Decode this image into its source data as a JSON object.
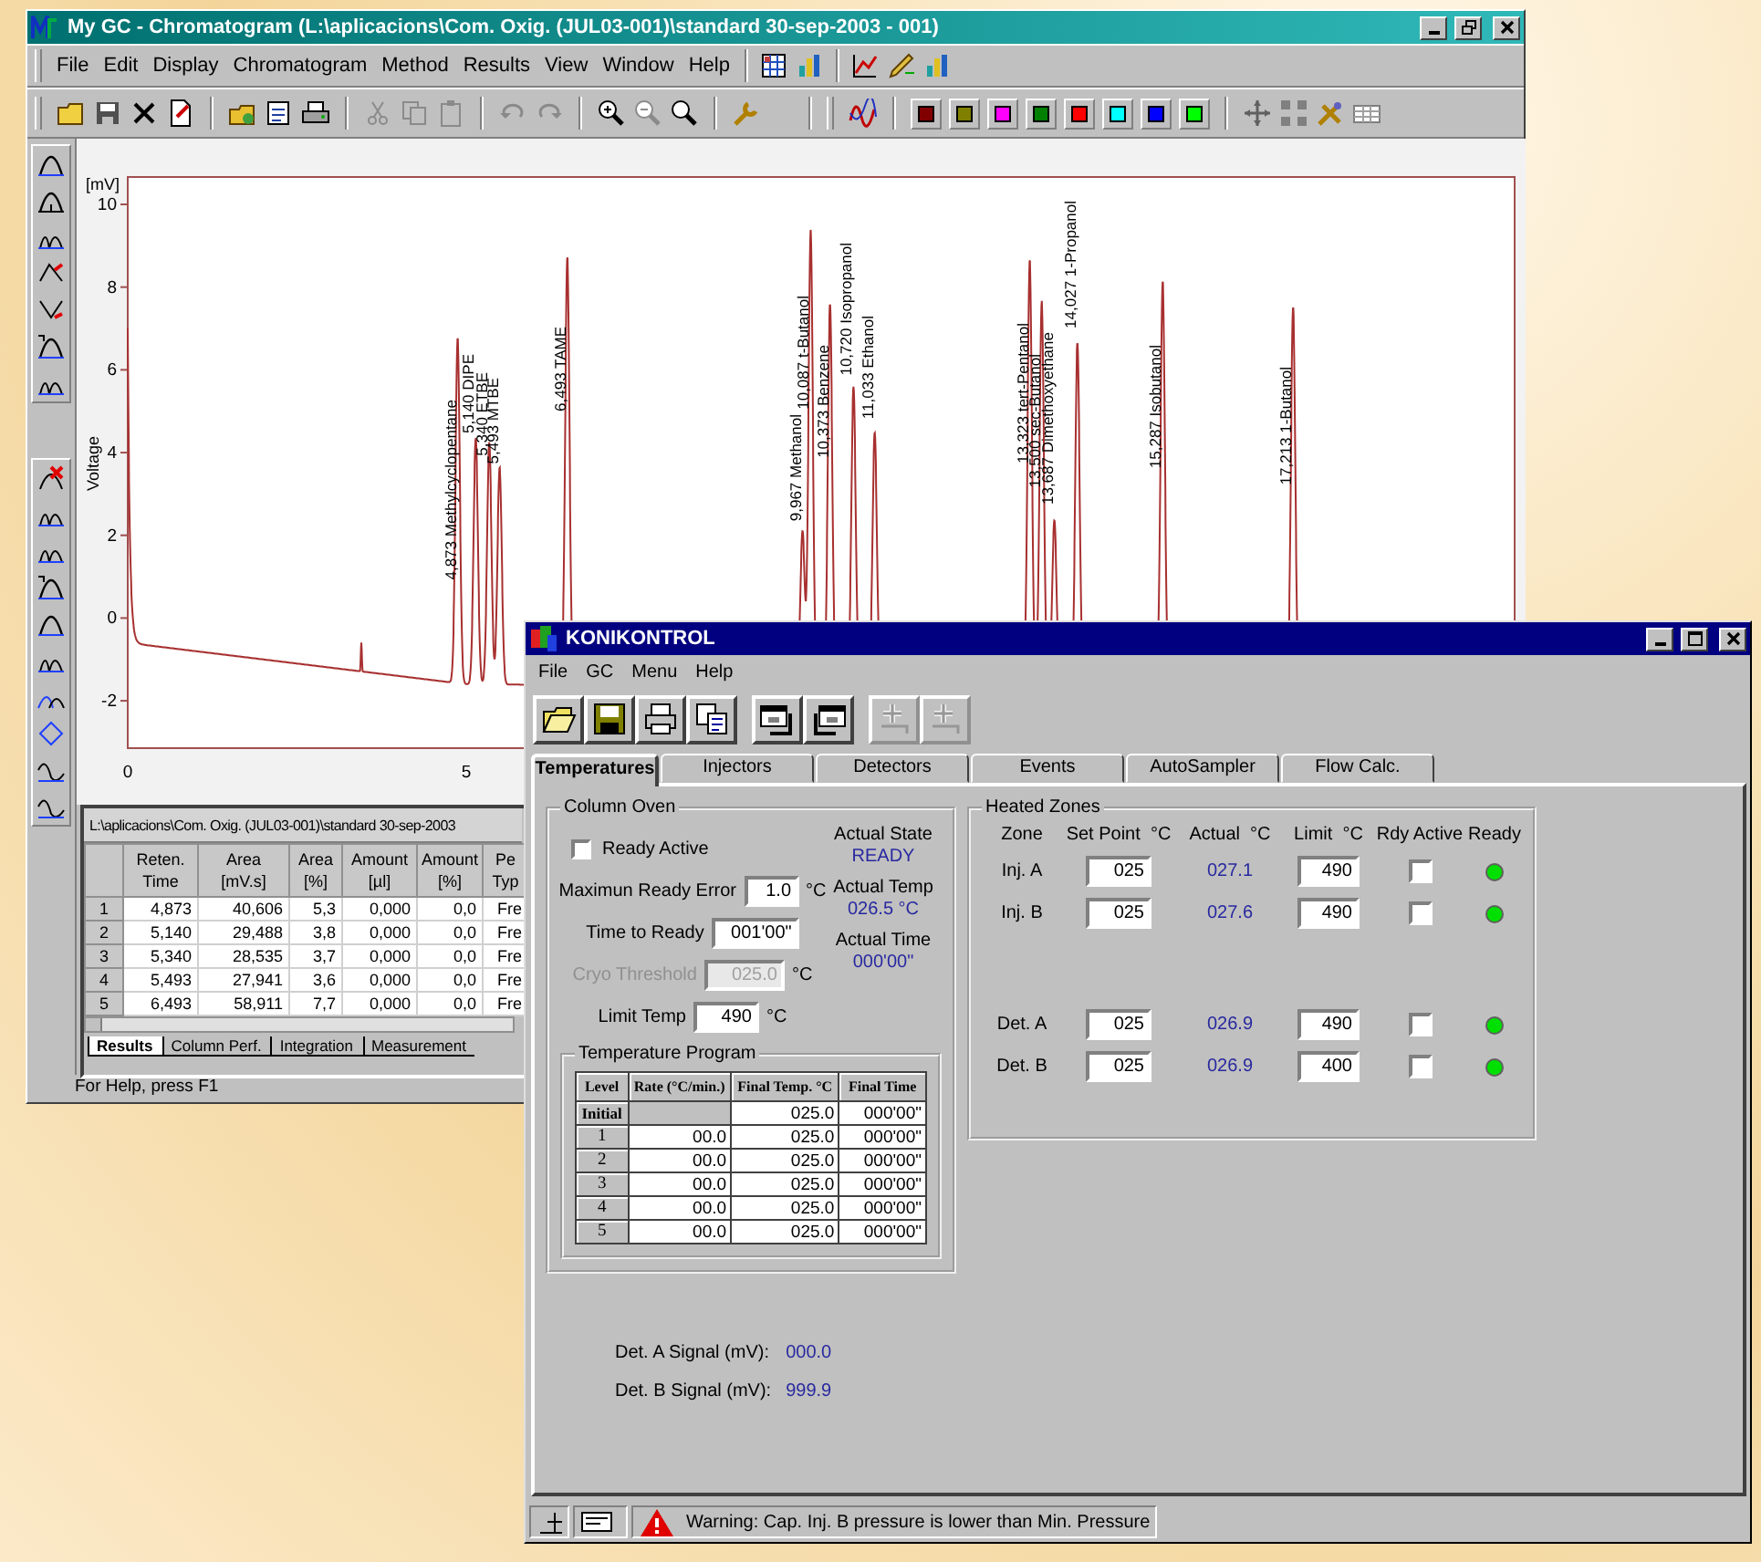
{
  "gc_window": {
    "title": "My GC - Chromatogram (L:\\aplicacions\\Com. Oxig. (JUL03-001)\\standard 30-sep-2003 - 001)",
    "menu": [
      "File",
      "Edit",
      "Display",
      "Chromatogram",
      "Method",
      "Results",
      "View",
      "Window",
      "Help"
    ],
    "trace_colors": [
      {
        "color": "#800000"
      },
      {
        "color": "#808000"
      },
      {
        "color": "#ff00ff"
      },
      {
        "color": "#008000"
      },
      {
        "color": "#ff0000"
      },
      {
        "color": "#00ffff"
      },
      {
        "color": "#0000ff"
      },
      {
        "color": "#00ff00"
      }
    ],
    "chart": {
      "y_unit": "[mV]",
      "y_title": "Voltage",
      "y_ticks": [
        "10",
        "8",
        "6",
        "4",
        "2",
        "0",
        "-2"
      ],
      "x_ticks": [
        "0",
        "5"
      ],
      "peak_labels": [
        "4,873 Methylcyclopentane",
        "5,140 DIPE",
        "5,340 ETBE",
        "5,493 MTBE",
        "6,493 TAME",
        "9,967 Methanol",
        "10,087 t-Butanol",
        "10,373 Benzene",
        "10,720 Isopropanol",
        "11,033 Ethanol",
        "13,323 tert-Pentanol",
        "13,500 sec-Butanol",
        "13,687 Dimethoxyethane",
        "14,027 1-Propanol",
        "15,287 Isobutanol",
        "17,213 1-Butanol"
      ]
    },
    "results": {
      "path": "L:\\aplicacions\\Com. Oxig. (JUL03-001)\\standard 30-sep-2003",
      "columns": [
        "",
        "Reten. Time",
        "Area [mV.s]",
        "Area [%]",
        "Amount [µl]",
        "Amount [%]",
        "Pe Typ"
      ],
      "rows": [
        [
          "1",
          "4,873",
          "40,606",
          "5,3",
          "0,000",
          "0,0",
          "Fre"
        ],
        [
          "2",
          "5,140",
          "29,488",
          "3,8",
          "0,000",
          "0,0",
          "Fre"
        ],
        [
          "3",
          "5,340",
          "28,535",
          "3,7",
          "0,000",
          "0,0",
          "Fre"
        ],
        [
          "4",
          "5,493",
          "27,941",
          "3,6",
          "0,000",
          "0,0",
          "Fre"
        ],
        [
          "5",
          "6,493",
          "58,911",
          "7,7",
          "0,000",
          "0,0",
          "Fre"
        ]
      ],
      "tabs": [
        {
          "label": "Results",
          "selected": true
        },
        {
          "label": "Column Perf.",
          "selected": false
        },
        {
          "label": "Integration",
          "selected": false
        },
        {
          "label": "Measurement",
          "selected": false
        }
      ]
    },
    "status_bar": "For Help, press F1"
  },
  "konikontrol": {
    "title": "KONIKONTROL",
    "menu": [
      "File",
      "GC",
      "Menu",
      "Help"
    ],
    "toolbar": [
      {
        "kind": "open",
        "disabled": false
      },
      {
        "kind": "save",
        "disabled": false
      },
      {
        "kind": "print",
        "disabled": false
      },
      {
        "kind": "copy",
        "disabled": false
      },
      {
        "kind": "window-in",
        "disabled": false
      },
      {
        "kind": "window-out",
        "disabled": false
      },
      {
        "kind": "add",
        "disabled": true
      },
      {
        "kind": "add",
        "disabled": true
      }
    ],
    "tabs": [
      {
        "label": "Temperatures",
        "selected": true
      },
      {
        "label": "Injectors",
        "selected": false
      },
      {
        "label": "Detectors",
        "selected": false
      },
      {
        "label": "Events",
        "selected": false
      },
      {
        "label": "AutoSampler",
        "selected": false
      },
      {
        "label": "Flow Calc.",
        "selected": false
      }
    ],
    "column_oven": {
      "title": "Column Oven",
      "ready_active": {
        "label": "Ready Active",
        "checked": false
      },
      "fields": [
        {
          "label": "Maximun Ready Error",
          "value": "1.0",
          "unit": "°C",
          "disabled": false
        },
        {
          "label": "Time to Ready",
          "value": "001'00\"",
          "disabled": false
        },
        {
          "label": "Cryo Threshold",
          "value": "025.0",
          "unit": "°C",
          "disabled": true
        },
        {
          "label": "Limit Temp",
          "value": "490",
          "unit": "°C",
          "disabled": false
        }
      ],
      "actual": [
        {
          "label": "Actual State",
          "value": "READY"
        },
        {
          "label": "Actual Temp",
          "value": "026.5  °C"
        },
        {
          "label": "Actual Time",
          "value": "000'00\""
        }
      ],
      "program": {
        "title": "Temperature Program",
        "columns": [
          "Level",
          "Rate (°C/min.)",
          "Final Temp. °C",
          "Final Time"
        ],
        "rows": [
          {
            "level": "Initial",
            "final_temp": "025.0",
            "final_time": "000'00\""
          },
          {
            "level": "1",
            "rate": "00.0",
            "final_temp": "025.0",
            "final_time": "000'00\""
          },
          {
            "level": "2",
            "rate": "00.0",
            "final_temp": "025.0",
            "final_time": "000'00\""
          },
          {
            "level": "3",
            "rate": "00.0",
            "final_temp": "025.0",
            "final_time": "000'00\""
          },
          {
            "level": "4",
            "rate": "00.0",
            "final_temp": "025.0",
            "final_time": "000'00\""
          },
          {
            "level": "5",
            "rate": "00.0",
            "final_temp": "025.0",
            "final_time": "000'00\""
          }
        ]
      }
    },
    "heated_zones": {
      "title": "Heated Zones",
      "columns": [
        "Zone",
        "Set Point  °C",
        "Actual  °C",
        "Limit  °C",
        "Rdy Active",
        "Ready"
      ],
      "groups": [
        {
          "zones": [
            {
              "zone": "Inj. A",
              "set_point": "025",
              "actual": "027.1",
              "limit": "490",
              "rdy_active": false,
              "ready": true
            },
            {
              "zone": "Inj. B",
              "set_point": "025",
              "actual": "027.6",
              "limit": "490",
              "rdy_active": false,
              "ready": true
            }
          ]
        },
        {
          "zones": [
            {
              "zone": "Det. A",
              "set_point": "025",
              "actual": "026.9",
              "limit": "490",
              "rdy_active": false,
              "ready": true
            },
            {
              "zone": "Det. B",
              "set_point": "025",
              "actual": "026.9",
              "limit": "400",
              "rdy_active": false,
              "ready": true
            }
          ]
        }
      ]
    },
    "signals": [
      {
        "label": "Det. A Signal (mV):",
        "value": "000.0"
      },
      {
        "label": "Det. B Signal (mV):",
        "value": "999.9"
      }
    ],
    "status": {
      "message": "Warning: Cap. Inj. B pressure is lower than Min. Pressure"
    }
  }
}
